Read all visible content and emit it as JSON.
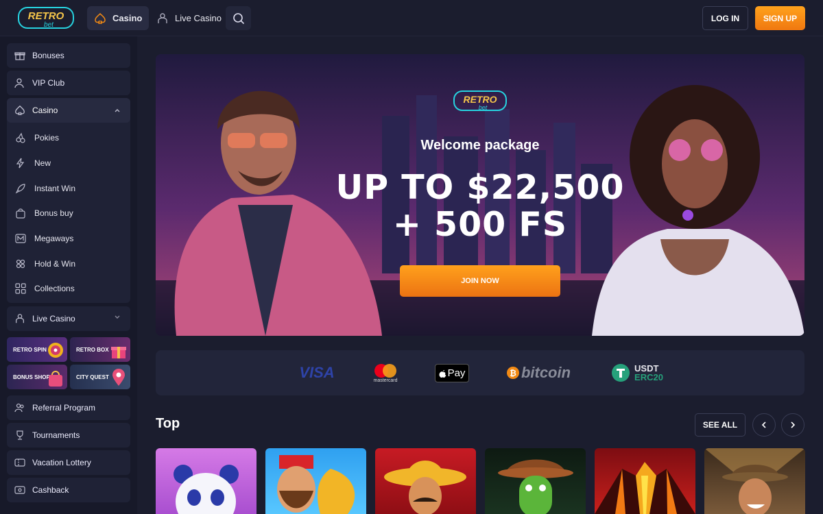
{
  "header": {
    "nav": [
      {
        "label": "Casino",
        "icon": "spade-icon"
      },
      {
        "label": "Live Casino",
        "icon": "dealer-icon"
      }
    ],
    "login_label": "LOG IN",
    "signup_label": "SIGN UP"
  },
  "sidebar": {
    "items_top": [
      {
        "label": "Bonuses",
        "icon": "gift-icon"
      },
      {
        "label": "VIP Club",
        "icon": "vip-icon"
      }
    ],
    "casino": {
      "label": "Casino",
      "subitems": [
        {
          "label": "Pokies",
          "icon": "cherries-icon"
        },
        {
          "label": "New",
          "icon": "lightning-icon"
        },
        {
          "label": "Instant Win",
          "icon": "rocket-icon"
        },
        {
          "label": "Bonus buy",
          "icon": "bag-icon"
        },
        {
          "label": "Megaways",
          "icon": "megaways-icon"
        },
        {
          "label": "Hold & Win",
          "icon": "coins-icon"
        },
        {
          "label": "Collections",
          "icon": "grid-icon"
        }
      ]
    },
    "live_casino": {
      "label": "Live Casino",
      "icon": "dealer-icon"
    },
    "promos": [
      {
        "label": "RETRO SPIN",
        "color": "#3a2a6a"
      },
      {
        "label": "RETRO BOX",
        "color": "#4a2a5a"
      },
      {
        "label": "BONUS SHOP",
        "color": "#3a2a5a"
      },
      {
        "label": "CITY QUEST",
        "color": "#2e3a5e"
      }
    ],
    "items_bottom": [
      {
        "label": "Referral Program",
        "icon": "people-icon"
      },
      {
        "label": "Tournaments",
        "icon": "trophy-icon"
      },
      {
        "label": "Vacation Lottery",
        "icon": "ticket-icon"
      },
      {
        "label": "Cashback",
        "icon": "cashback-icon"
      }
    ]
  },
  "hero": {
    "logo_text_1": "RETRO",
    "logo_text_2": "bet",
    "welcome": "Welcome package",
    "amount_line1": "UP TO $22,500",
    "amount_line2": "+ 500 FS",
    "cta": "JOIN NOW"
  },
  "payments": {
    "visa": "VISA",
    "mastercard": "mastercard",
    "applepay": "Pay",
    "bitcoin": "bitcoin",
    "usdt_1": "USDT",
    "usdt_2": "ERC20"
  },
  "top_section": {
    "title": "Top",
    "see_all": "SEE ALL"
  },
  "colors": {
    "accent": "#f28a14",
    "background": "#1b1d2e",
    "panel": "#1f2236"
  }
}
